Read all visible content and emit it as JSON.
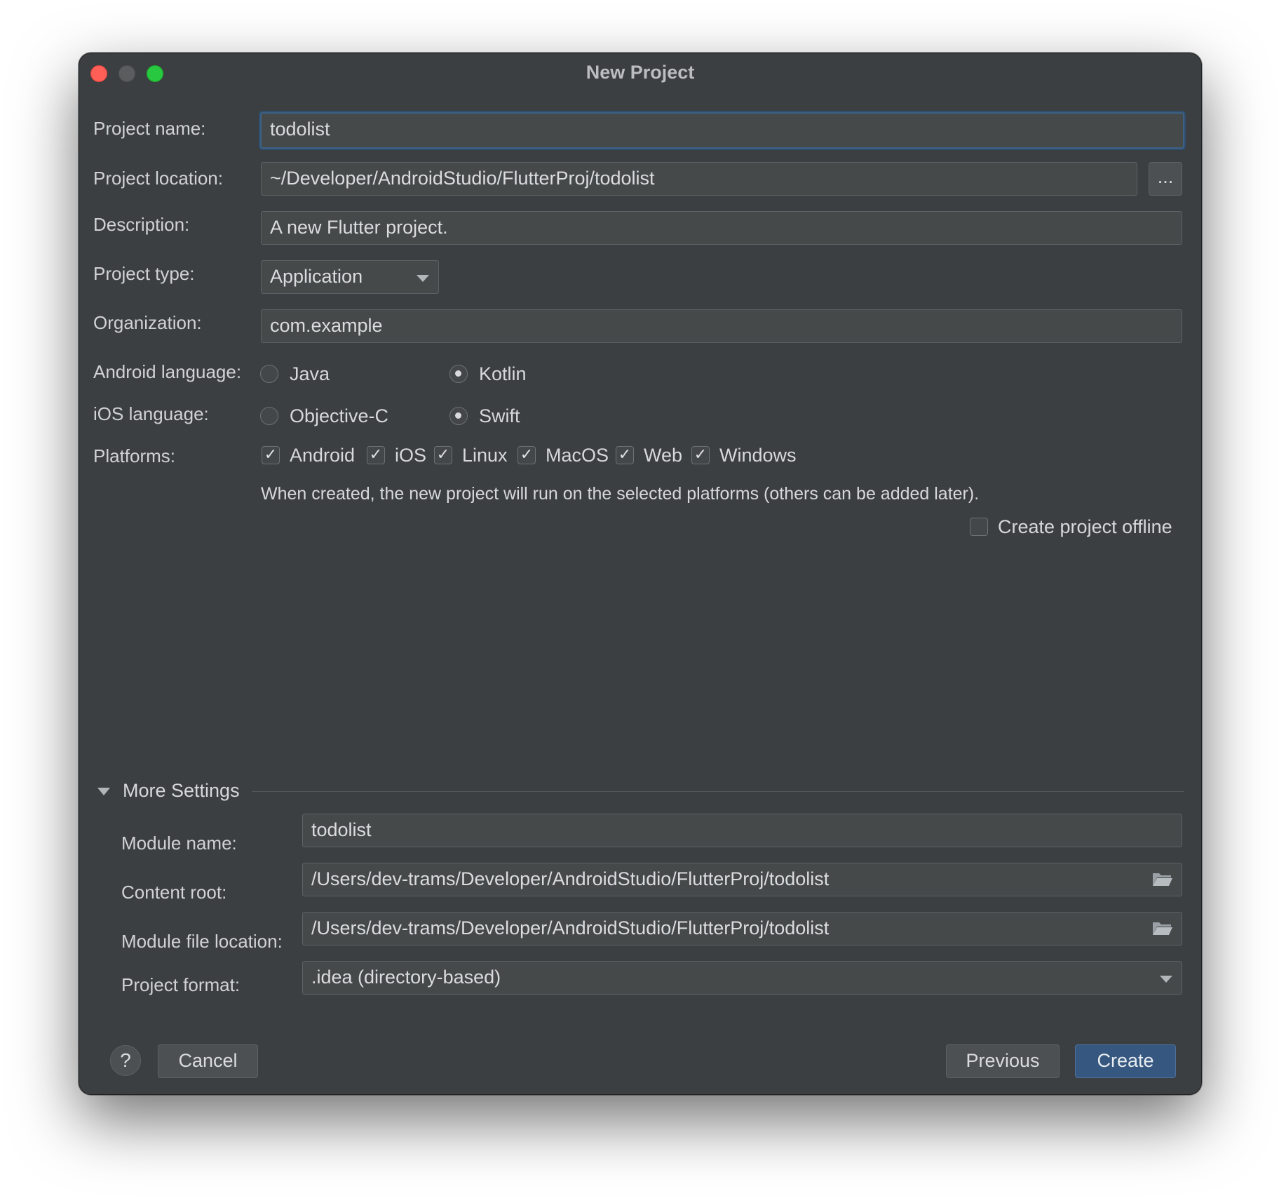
{
  "window": {
    "title": "New Project"
  },
  "form": {
    "project_name": {
      "label": "Project name:",
      "value": "todolist"
    },
    "project_location": {
      "label": "Project location:",
      "value": "~/Developer/AndroidStudio/FlutterProj/todolist",
      "browse_label": "..."
    },
    "description": {
      "label": "Description:",
      "value": "A new Flutter project."
    },
    "project_type": {
      "label": "Project type:",
      "value": "Application"
    },
    "organization": {
      "label": "Organization:",
      "value": "com.example"
    },
    "android_language": {
      "label": "Android language:",
      "options": [
        "Java",
        "Kotlin"
      ],
      "selected": "Kotlin"
    },
    "ios_language": {
      "label": "iOS language:",
      "options": [
        "Objective-C",
        "Swift"
      ],
      "selected": "Swift"
    },
    "platforms": {
      "label": "Platforms:",
      "items": [
        {
          "name": "Android",
          "checked": true
        },
        {
          "name": "iOS",
          "checked": true
        },
        {
          "name": "Linux",
          "checked": true
        },
        {
          "name": "MacOS",
          "checked": true
        },
        {
          "name": "Web",
          "checked": true
        },
        {
          "name": "Windows",
          "checked": true
        }
      ],
      "hint": "When created, the new project will run on the selected platforms (others can be added later)."
    },
    "create_offline": {
      "label": "Create project offline",
      "checked": false
    }
  },
  "more_settings": {
    "title": "More Settings",
    "expanded": true,
    "module_name": {
      "label": "Module name:",
      "value": "todolist"
    },
    "content_root": {
      "label": "Content root:",
      "value": "/Users/dev-trams/Developer/AndroidStudio/FlutterProj/todolist"
    },
    "module_file_location": {
      "label": "Module file location:",
      "value": "/Users/dev-trams/Developer/AndroidStudio/FlutterProj/todolist"
    },
    "project_format": {
      "label": "Project format:",
      "value": ".idea (directory-based)"
    }
  },
  "footer": {
    "help_label": "?",
    "cancel_label": "Cancel",
    "previous_label": "Previous",
    "create_label": "Create"
  },
  "colors": {
    "background": "#3c3f41",
    "field": "#45494a",
    "accent": "#365880",
    "focus": "#3d6185"
  }
}
